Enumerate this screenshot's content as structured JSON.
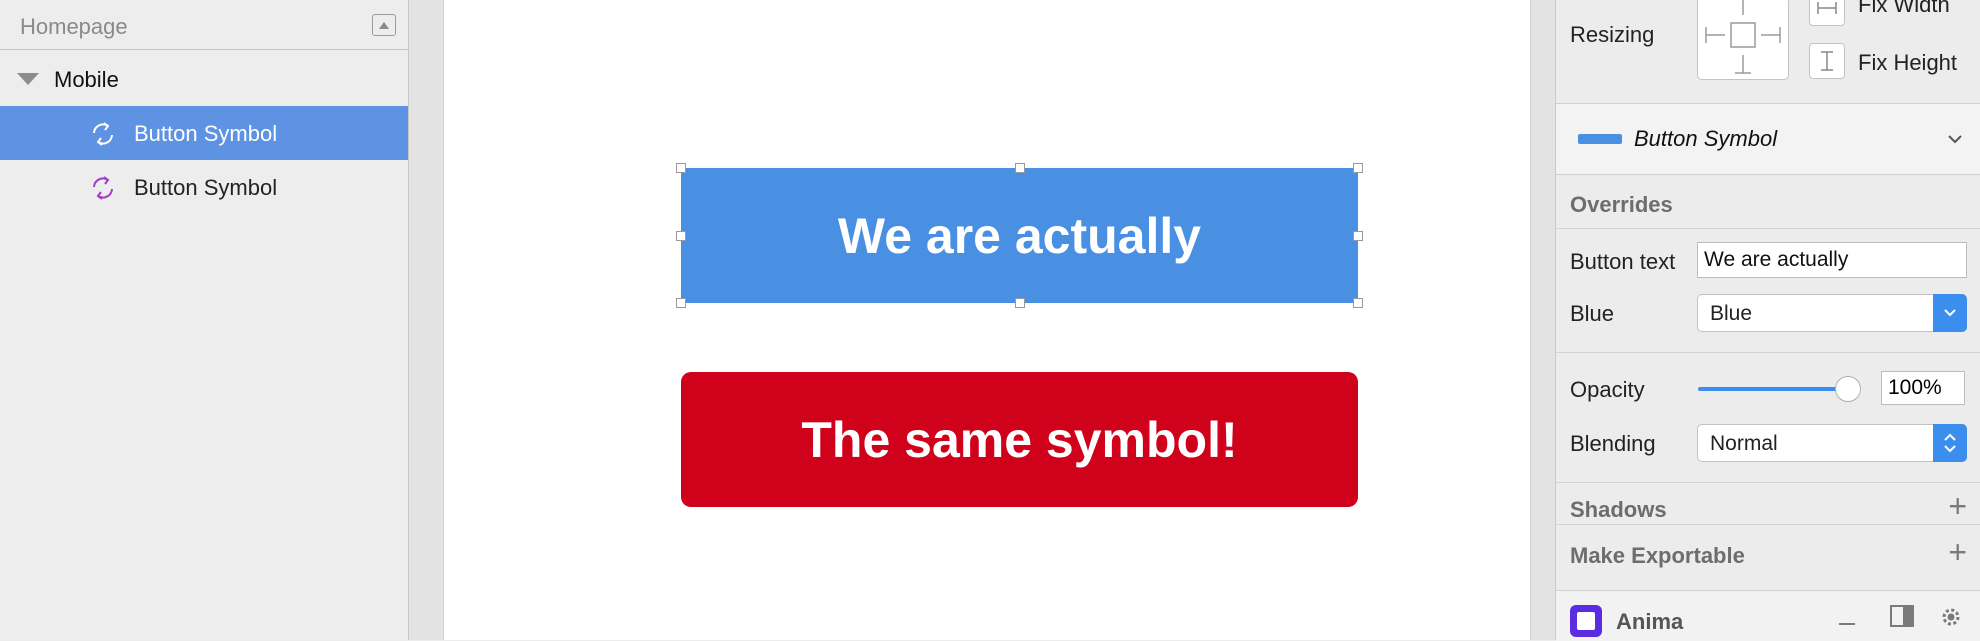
{
  "layers": {
    "page_title": "Homepage",
    "group": {
      "label": "Mobile"
    },
    "items": [
      {
        "label": "Button Symbol",
        "selected": true
      },
      {
        "label": "Button Symbol",
        "selected": false
      }
    ]
  },
  "canvas": {
    "buttons": [
      {
        "text": "We are actually",
        "color": "#4a90e2"
      },
      {
        "text": "The same symbol!",
        "color": "#d0011b"
      }
    ]
  },
  "inspector": {
    "resizing": {
      "label": "Resizing",
      "fix_width": "Fix Width",
      "fix_height": "Fix Height"
    },
    "symbol": {
      "name": "Button Symbol"
    },
    "overrides": {
      "title": "Overrides",
      "button_text_label": "Button text",
      "button_text_value": "We are actually",
      "style_label": "Blue",
      "style_value": "Blue"
    },
    "opacity": {
      "label": "Opacity",
      "value": "100%",
      "level": 1.0
    },
    "blending": {
      "label": "Blending",
      "value": "Normal"
    },
    "shadows": {
      "title": "Shadows"
    },
    "export": {
      "title": "Make Exportable"
    },
    "plugin": {
      "name": "Anima"
    }
  },
  "colors": {
    "selection": "#5e92e2",
    "accent": "#3b8eee"
  }
}
